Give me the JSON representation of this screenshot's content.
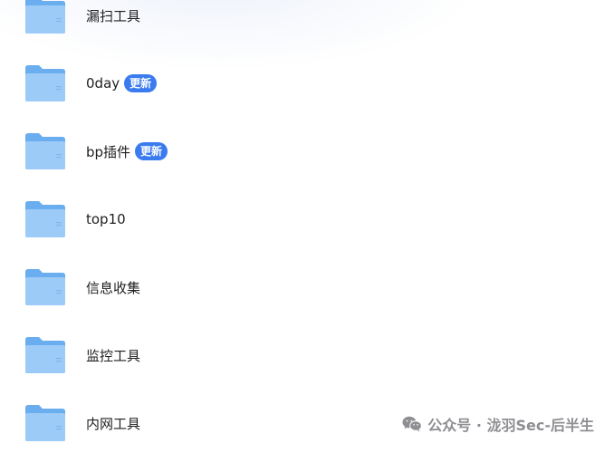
{
  "folders": [
    {
      "name": "漏扫工具",
      "badge": ""
    },
    {
      "name": "0day",
      "badge": "更新"
    },
    {
      "name": "bp插件",
      "badge": "更新"
    },
    {
      "name": "top10",
      "badge": ""
    },
    {
      "name": "信息收集",
      "badge": ""
    },
    {
      "name": "监控工具",
      "badge": ""
    },
    {
      "name": "内网工具",
      "badge": ""
    }
  ],
  "watermark": {
    "text": "公众号 · 泷羽Sec-后半生",
    "icon": "wechat-icon"
  },
  "colors": {
    "badge": "#3a7bf0",
    "folder_back": "#6aaef0",
    "folder_front": "#9ccbf7",
    "watermark": "#8e8e93"
  }
}
